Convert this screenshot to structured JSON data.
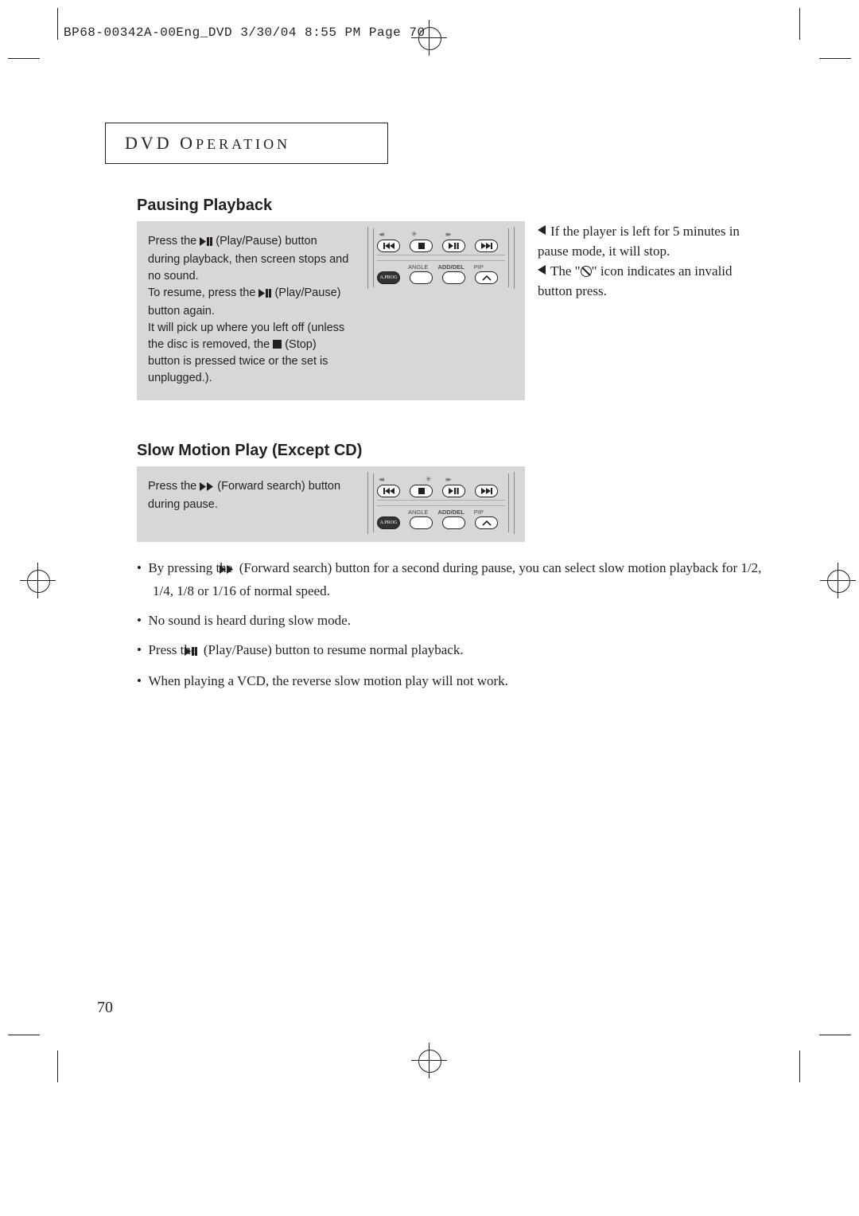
{
  "prepress_header": "BP68-00342A-00Eng_DVD  3/30/04  8:55 PM  Page 70",
  "page_title": "DVD OPERATION",
  "page_number": "70",
  "headings": {
    "pausing": "Pausing Playback",
    "slowmo": "Slow Motion Play (Except CD)"
  },
  "graybox1": {
    "line1a": "Press the ",
    "line1b": " (Play/Pause) button during playback, then screen stops and no sound.",
    "line2a": "To resume, press the ",
    "line2b": " (Play/Pause) button again.",
    "line3a": "It will pick up where you left off (unless the disc is removed, the ",
    "line3b": " (Stop) button is pressed twice or the set is unplugged.)."
  },
  "side": {
    "n1": "If the player is left for 5 minutes in pause mode, it will stop.",
    "n2a": "The \"",
    "n2b": "\" icon indicates an invalid button press."
  },
  "graybox2": {
    "line1a": "Press the ",
    "line1b": " (Forward search) button during pause."
  },
  "bullets": {
    "b1a": "By pressing the ",
    "b1b": " (Forward search) button for a second during pause, you can select slow motion playback for 1/2, 1/4, 1/8 or 1/16 of normal speed.",
    "b2": "No sound is heard during slow mode.",
    "b3a": "Press the ",
    "b3b": " (Play/Pause) button to resume normal playback.",
    "b4": "When playing a VCD, the reverse slow motion play will not work."
  },
  "remote": {
    "row1_icons": [
      "skip-back",
      "stop",
      "play-pause",
      "skip-fwd"
    ],
    "row1_top": {
      "left": "◂◂",
      "right": "▸▸"
    },
    "row2_labels": [
      "ANGLE",
      "ADD/DEL",
      "PIP"
    ],
    "row2_first": "A.PROG"
  }
}
